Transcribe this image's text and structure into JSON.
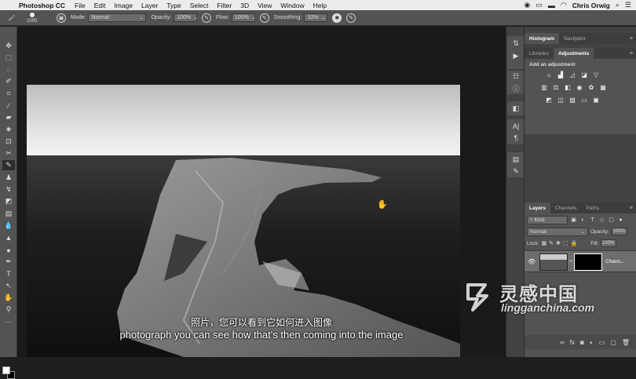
{
  "menubar": {
    "app_name": "Photoshop CC",
    "menus": [
      "File",
      "Edit",
      "Image",
      "Layer",
      "Type",
      "Select",
      "Filter",
      "3D",
      "View",
      "Window",
      "Help"
    ],
    "user": "Chris Orwig"
  },
  "options_bar": {
    "brush_size": "1000",
    "mode_label": "Mode:",
    "mode_value": "Normal",
    "opacity_label": "Opacity:",
    "opacity_value": "100%",
    "flow_label": "Flow:",
    "flow_value": "100%",
    "smoothing_label": "Smoothing:",
    "smoothing_value": "10%"
  },
  "panels": {
    "top_tabs": [
      "Histogram",
      "Navigator"
    ],
    "mid_tabs": [
      "Libraries",
      "Adjustments"
    ],
    "adjustments_hint": "Add an adjustment",
    "layers_tabs": [
      "Layers",
      "Channels",
      "Paths"
    ],
    "layers": {
      "kind_label": "Kind",
      "blend_mode": "Normal",
      "opacity_label": "Opacity:",
      "opacity_value": "100%",
      "lock_label": "Lock:",
      "fill_label": "Fill:",
      "fill_value": "100%",
      "layer_name": "Chann..."
    }
  },
  "subtitles": {
    "zh": "照片，您可以看到它如何进入图像",
    "en": "photograph you can see how that's then coming into the image"
  },
  "watermark": {
    "cn": "灵感中国",
    "en": "lingganchina.com"
  },
  "colors": {
    "menubar_bg": "#ececec",
    "panel_bg": "#535353",
    "canvas_bg": "#1a1a1a"
  }
}
